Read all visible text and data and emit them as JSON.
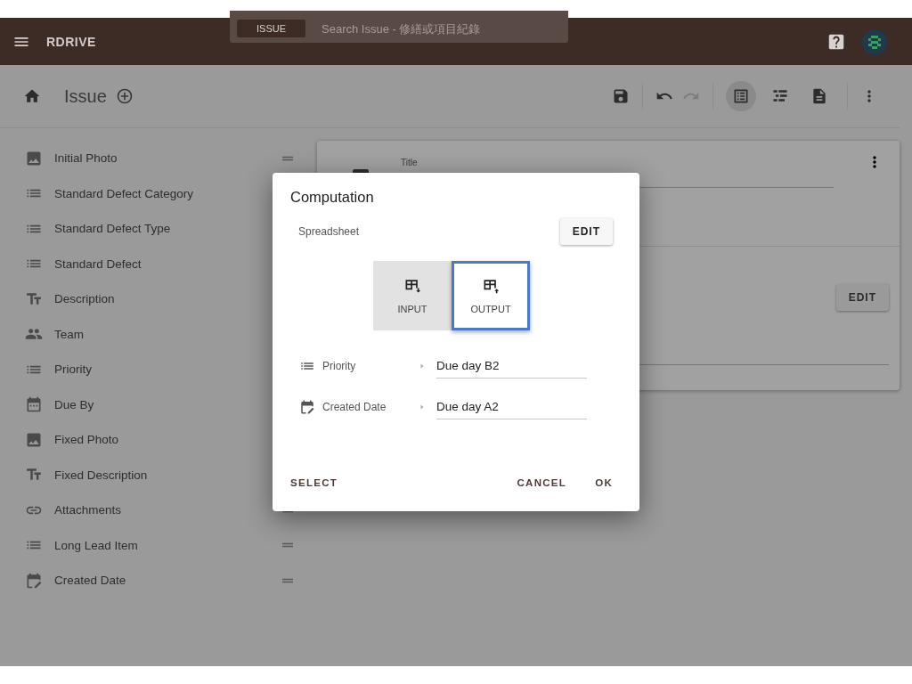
{
  "app_bar": {
    "logo": "RDRIVE",
    "search": {
      "scope": "ISSUE",
      "placeholder": "Search Issue - 修繕或項目紀錄"
    }
  },
  "toolbar": {
    "title": "Issue",
    "views": [
      {
        "kind": "list",
        "selected": true
      },
      {
        "kind": "tree",
        "selected": false
      },
      {
        "kind": "document",
        "selected": false
      }
    ],
    "redo_disabled": true
  },
  "sidebar": {
    "items": [
      {
        "kind": "image",
        "label": "Initial Photo",
        "drag_handle": true
      },
      {
        "kind": "list",
        "label": "Standard Defect Category",
        "drag_handle": false
      },
      {
        "kind": "list",
        "label": "Standard Defect Type",
        "drag_handle": false
      },
      {
        "kind": "list",
        "label": "Standard Defect",
        "drag_handle": false
      },
      {
        "kind": "text",
        "label": "Description",
        "drag_handle": false
      },
      {
        "kind": "team",
        "label": "Team",
        "drag_handle": false
      },
      {
        "kind": "list",
        "label": "Priority",
        "drag_handle": false
      },
      {
        "kind": "calendar",
        "label": "Due By",
        "drag_handle": false
      },
      {
        "kind": "image",
        "label": "Fixed Photo",
        "drag_handle": false
      },
      {
        "kind": "text",
        "label": "Fixed Description",
        "drag_handle": false
      },
      {
        "kind": "link",
        "label": "Attachments",
        "drag_handle": true
      },
      {
        "kind": "list",
        "label": "Long Lead Item",
        "drag_handle": true
      },
      {
        "kind": "calendar-edit",
        "label": "Created Date",
        "drag_handle": true
      }
    ]
  },
  "card": {
    "field_label": "Title",
    "edit_button": "EDIT"
  },
  "dialog": {
    "title": "Computation",
    "source_label": "Spreadsheet",
    "edit_button": "EDIT",
    "modes": [
      {
        "kind": "input",
        "label": "INPUT",
        "selected": true,
        "focused": false
      },
      {
        "kind": "output",
        "label": "OUTPUT",
        "selected": false,
        "focused": true
      }
    ],
    "mappings": [
      {
        "kind": "list",
        "label": "Priority",
        "value": "Due day B2"
      },
      {
        "kind": "calendar-edit",
        "label": "Created Date",
        "value": "Due day A2"
      }
    ],
    "actions": {
      "left": "SELECT",
      "cancel": "CANCEL",
      "ok": "OK"
    }
  }
}
